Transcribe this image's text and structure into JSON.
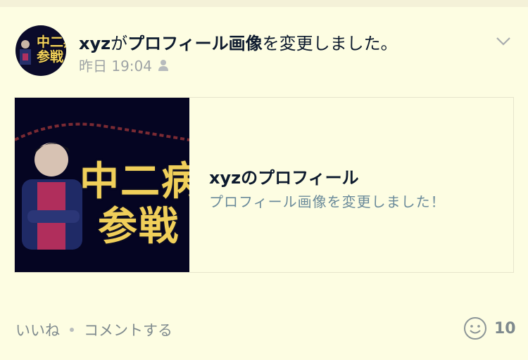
{
  "post": {
    "user": "xyz",
    "action_particle": "が",
    "action_bold": "プロフィール画像",
    "action_rest": "を変更しました。",
    "time": "昨日 19:04",
    "avatar_text": "中二病\n参戦"
  },
  "link_card": {
    "title": "xyzのプロフィール",
    "subtitle": "プロフィール画像を変更しました！",
    "thumb_line1": "中二病",
    "thumb_line2": "参戦"
  },
  "actions": {
    "like": "いいね",
    "comment": "コメントする",
    "reaction_count": "10"
  },
  "icons": {
    "privacy": "person-icon",
    "menu": "chevron-down-icon",
    "reaction": "smiley-icon"
  },
  "colors": {
    "background": "#fdfde2",
    "text_dark": "#0d1a2e",
    "text_muted": "#9ea3a5",
    "accent_yellow": "#f0cf5a"
  }
}
